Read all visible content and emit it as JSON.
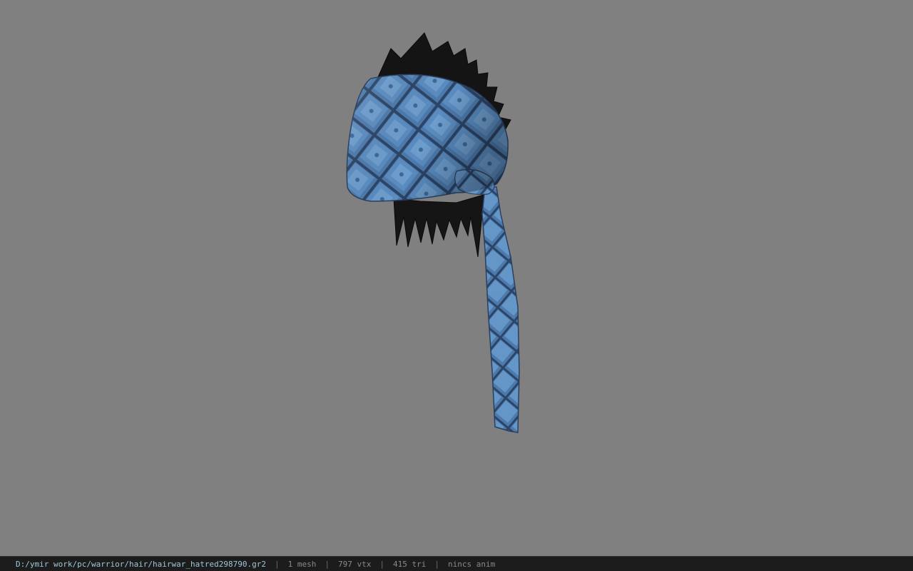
{
  "viewport": {
    "background_color": "#808080",
    "model": {
      "bandana_color": "#4a77a8",
      "pattern_color": "#2c4264",
      "hair_color": "#141414"
    }
  },
  "status_bar": {
    "file_path": "D:/ymir work/pc/warrior/hair/hairwar_hatred298790.gr2",
    "separator": "|",
    "mesh_count": "1 mesh",
    "vertex_count": "797 vtx",
    "triangle_count": "415 tri",
    "anim_status": "nincs anim"
  }
}
